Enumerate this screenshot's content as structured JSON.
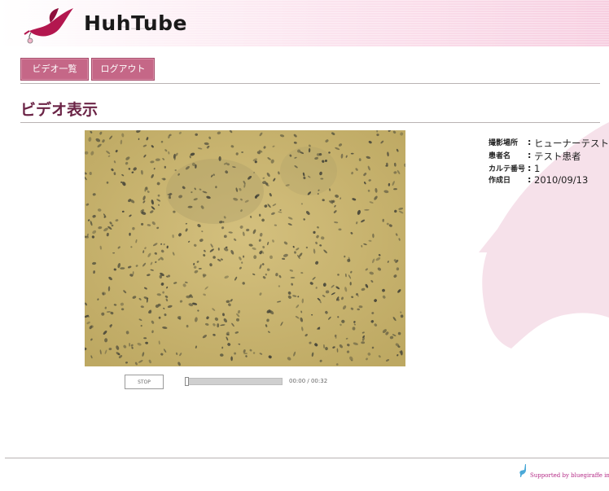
{
  "app": {
    "logo_text": "HuhTube"
  },
  "nav": {
    "video_list": "ビデオ一覧",
    "logout": "ログアウト"
  },
  "page": {
    "title": "ビデオ表示"
  },
  "player": {
    "stop_label": "STOP",
    "time": "00:00 / 00:32",
    "progress": 0.0
  },
  "info": [
    {
      "label": "撮影場所",
      "value": "ヒューナーテスト"
    },
    {
      "label": "患者名",
      "value": "テスト患者"
    },
    {
      "label": "カルテ番号",
      "value": "1"
    },
    {
      "label": "作成日",
      "value": "2010/09/13"
    }
  ],
  "info_separator": ":",
  "footer": {
    "text": "Supported by bluegiraffe inc."
  },
  "colors": {
    "accent": "#c56787",
    "title": "#6b2446",
    "footer": "#b42a86"
  }
}
